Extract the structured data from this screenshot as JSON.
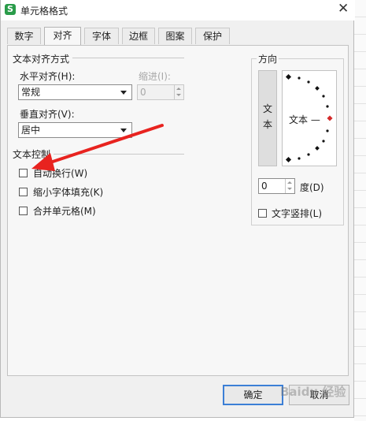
{
  "window": {
    "title": "单元格格式",
    "app_icon": "S"
  },
  "tabs": [
    {
      "label": "数字"
    },
    {
      "label": "对齐"
    },
    {
      "label": "字体"
    },
    {
      "label": "边框"
    },
    {
      "label": "图案"
    },
    {
      "label": "保护"
    }
  ],
  "active_tab": "对齐",
  "text_alignment": {
    "section_title": "文本对齐方式",
    "horizontal": {
      "label": "水平对齐(H):",
      "value": "常规"
    },
    "indent": {
      "label": "缩进(I):",
      "value": "0"
    },
    "vertical": {
      "label": "垂直对齐(V):",
      "value": "居中"
    }
  },
  "text_control": {
    "section_title": "文本控制",
    "options": [
      {
        "label": "自动换行(W)",
        "checked": false
      },
      {
        "label": "缩小字体填充(K)",
        "checked": false
      },
      {
        "label": "合并单元格(M)",
        "checked": false
      }
    ]
  },
  "orientation": {
    "title": "方向",
    "vertical_text": [
      "文",
      "本"
    ],
    "dial_text": "文本 —",
    "degree": {
      "value": "0",
      "label": "度(D)"
    },
    "vertical_checkbox": {
      "label": "文字竖排(L)",
      "checked": false
    }
  },
  "buttons": {
    "ok": "确定",
    "cancel": "取消"
  },
  "watermark_text": "Baidu 经验",
  "colors": {
    "arrow": "#e8231f",
    "dial_marker": "#d42a2a",
    "primary_border": "#3c7fd6"
  }
}
